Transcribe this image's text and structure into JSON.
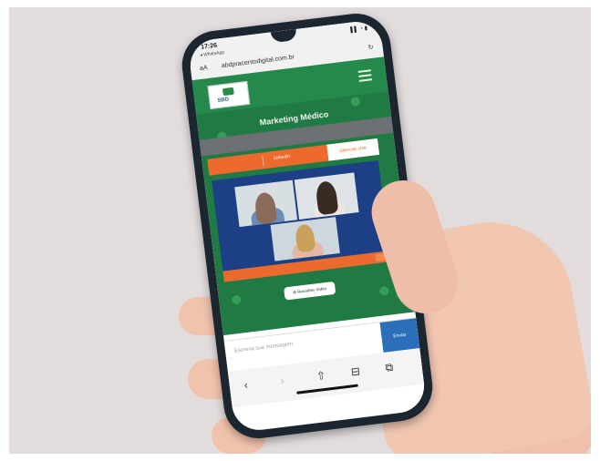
{
  "status": {
    "time": "17:26",
    "back_label": "◂ WhatsApp",
    "signal": "▌▌ ◔ ▮"
  },
  "browser": {
    "text_size": "aA",
    "url": "abdpracentodigital.com.br",
    "reload_icon": "reload-icon"
  },
  "site": {
    "logo_text": "SBD",
    "title": "Marketing Médico",
    "orange_label": "Linkedin",
    "orange_button": "Silenciar chat",
    "pill_label": "⊕ Reuniões Vídeo"
  },
  "chat": {
    "placeholder": "Escreva sua mensagem",
    "send_label": "Enviar"
  },
  "toolbar": {
    "back": "‹",
    "forward": "›",
    "share": "⇧",
    "bookmarks": "⊟",
    "tabs": "⧉"
  }
}
